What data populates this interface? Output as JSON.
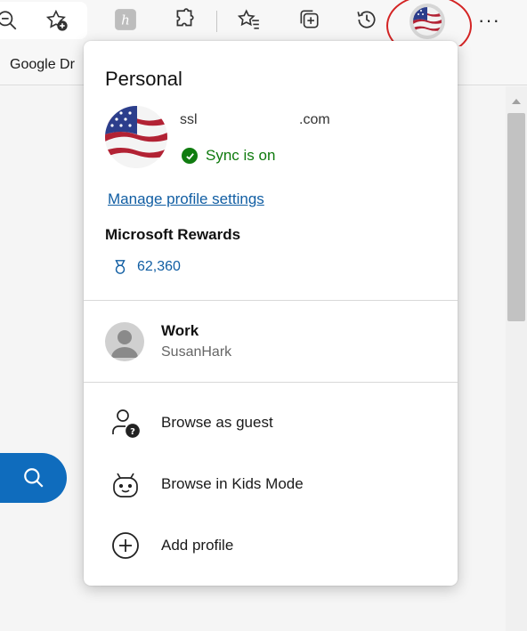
{
  "favorites_bar": {
    "item_label": "Google Dr"
  },
  "profile_flyout": {
    "heading": "Personal",
    "email_start": "ssl",
    "email_end": ".com",
    "sync_status": "Sync is on",
    "manage_link": "Manage profile settings",
    "rewards_title": "Microsoft Rewards",
    "rewards_points": "62,360",
    "other_profile": {
      "name": "Work",
      "username": "SusanHark"
    },
    "menu": [
      {
        "label": "Browse as guest",
        "icon": "guest-icon"
      },
      {
        "label": "Browse in Kids Mode",
        "icon": "kids-mode-icon"
      },
      {
        "label": "Add profile",
        "icon": "add-circle-icon"
      }
    ]
  },
  "colors": {
    "accent_blue": "#0f6cbd",
    "link_blue": "#115ea3",
    "sync_green": "#107c10",
    "highlight_red": "#d42424"
  }
}
